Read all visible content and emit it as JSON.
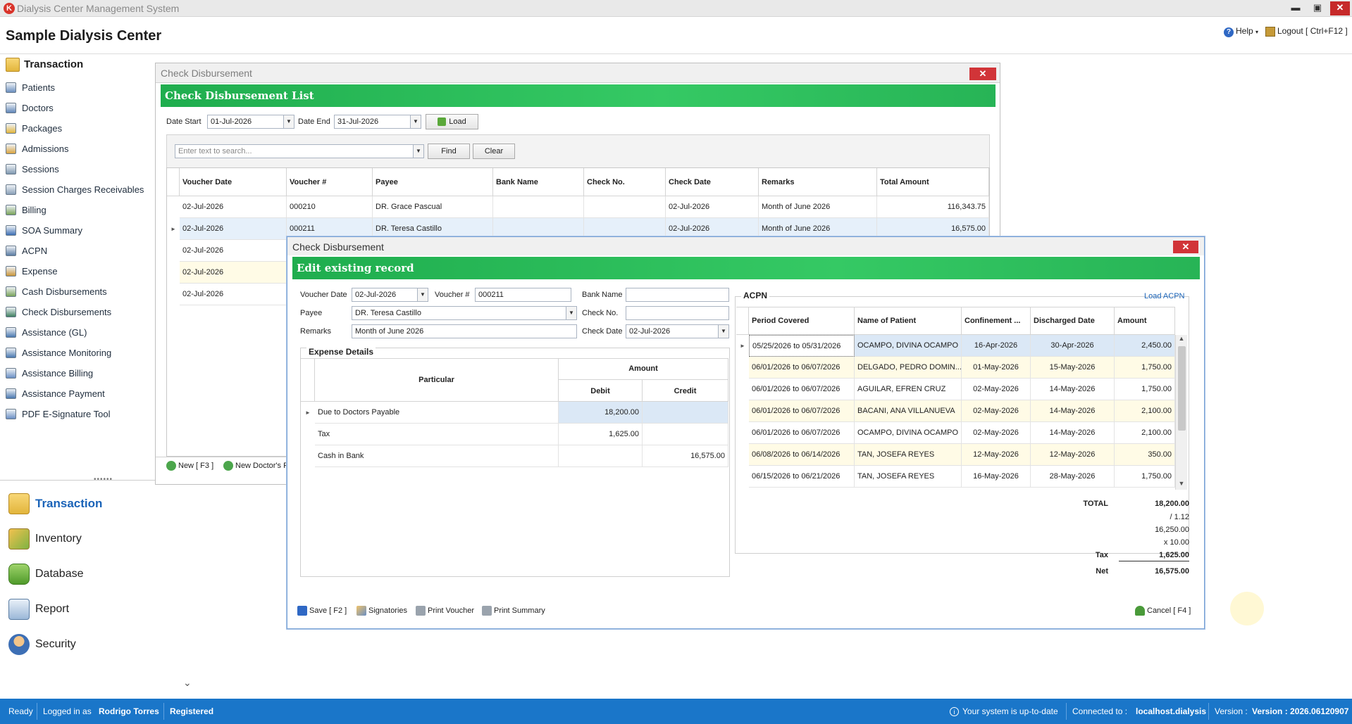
{
  "app": {
    "title": "Dialysis Center Management System",
    "logo_letter": "K",
    "window_controls": {
      "minimize": "▬",
      "restore": "▣",
      "close": "✕"
    }
  },
  "header": {
    "center_name": "Sample Dialysis Center",
    "help_label": "Help",
    "logout_label": "Logout [ Ctrl+F12 ]"
  },
  "sidebar": {
    "heading": "Transaction",
    "items": [
      {
        "label": "Patients",
        "icon": "patients-icon"
      },
      {
        "label": "Doctors",
        "icon": "doctors-icon"
      },
      {
        "label": "Packages",
        "icon": "packages-icon"
      },
      {
        "label": "Admissions",
        "icon": "admissions-icon"
      },
      {
        "label": "Sessions",
        "icon": "sessions-icon"
      },
      {
        "label": "Session Charges Receivables",
        "icon": "receivables-icon"
      },
      {
        "label": "Billing",
        "icon": "billing-icon"
      },
      {
        "label": "SOA Summary",
        "icon": "soa-icon"
      },
      {
        "label": "ACPN",
        "icon": "acpn-icon"
      },
      {
        "label": "Expense",
        "icon": "expense-icon"
      },
      {
        "label": "Cash Disbursements",
        "icon": "cash-icon"
      },
      {
        "label": "Check Disbursements",
        "icon": "check-icon"
      },
      {
        "label": "Assistance (GL)",
        "icon": "assistance-gl-icon"
      },
      {
        "label": "Assistance Monitoring",
        "icon": "monitoring-icon"
      },
      {
        "label": "Assistance Billing",
        "icon": "assistance-billing-icon"
      },
      {
        "label": "Assistance Payment",
        "icon": "assistance-payment-icon"
      },
      {
        "label": "PDF E-Signature Tool",
        "icon": "pen-icon"
      }
    ],
    "splitter": "••••••",
    "modules": [
      {
        "label": "Transaction",
        "icon": "folder-icon"
      },
      {
        "label": "Inventory",
        "icon": "boxes-icon"
      },
      {
        "label": "Database",
        "icon": "database-icon"
      },
      {
        "label": "Report",
        "icon": "report-icon"
      },
      {
        "label": "Security",
        "icon": "user-security-icon"
      }
    ],
    "expand_chevron": "⌄"
  },
  "list_window": {
    "title": "Check Disbursement",
    "banner": "Check Disbursement List",
    "date_start_label": "Date Start",
    "date_start": "01-Jul-2026",
    "date_end_label": "Date End",
    "date_end": "31-Jul-2026",
    "load_label": "Load",
    "search_placeholder": "Enter text to search...",
    "find_label": "Find",
    "clear_label": "Clear",
    "columns": [
      "Voucher Date",
      "Voucher #",
      "Payee",
      "Bank Name",
      "Check No.",
      "Check Date",
      "Remarks",
      "Total Amount"
    ],
    "rows": [
      [
        "02-Jul-2026",
        "000210",
        "DR. Grace Pascual",
        "",
        "",
        "02-Jul-2026",
        "Month of June 2026",
        "116,343.75"
      ],
      [
        "02-Jul-2026",
        "000211",
        "DR. Teresa Castillo",
        "",
        "",
        "02-Jul-2026",
        "Month of June 2026",
        "16,575.00"
      ],
      [
        "02-Jul-2026",
        "",
        "",
        "",
        "",
        "",
        "",
        ""
      ],
      [
        "02-Jul-2026",
        "",
        "",
        "",
        "",
        "",
        "",
        ""
      ],
      [
        "02-Jul-2026",
        "",
        "",
        "",
        "",
        "",
        "",
        ""
      ]
    ],
    "new_label": "New [ F3 ]",
    "new_doctor_label": "New Doctor's F"
  },
  "edit_dialog": {
    "title": "Check Disbursement",
    "banner": "Edit existing record",
    "voucher_date_label": "Voucher Date",
    "voucher_date": "02-Jul-2026",
    "voucher_no_label": "Voucher #",
    "voucher_no": "000211",
    "bank_name_label": "Bank Name",
    "bank_name": "",
    "payee_label": "Payee",
    "payee": "DR. Teresa Castillo",
    "check_no_label": "Check No.",
    "check_no": "",
    "remarks_label": "Remarks",
    "remarks": "Month of June 2026",
    "check_date_label": "Check Date",
    "check_date": "02-Jul-2026",
    "expense_title": "Expense Details",
    "expense_headers": {
      "particular": "Particular",
      "amount": "Amount",
      "debit": "Debit",
      "credit": "Credit"
    },
    "expense_rows": [
      {
        "particular": "Due to Doctors Payable",
        "debit": "18,200.00",
        "credit": ""
      },
      {
        "particular": "Tax",
        "debit": "1,625.00",
        "credit": ""
      },
      {
        "particular": "Cash in Bank",
        "debit": "",
        "credit": "16,575.00"
      }
    ],
    "acpn_title": "ACPN",
    "load_acpn_label": "Load ACPN",
    "acpn_columns": [
      "Period Covered",
      "Name of Patient",
      "Confinement ...",
      "Discharged Date",
      "Amount"
    ],
    "acpn_rows": [
      [
        "05/25/2026 to 05/31/2026",
        "OCAMPO, DIVINA OCAMPO",
        "16-Apr-2026",
        "30-Apr-2026",
        "2,450.00"
      ],
      [
        "06/01/2026 to 06/07/2026",
        "DELGADO, PEDRO DOMIN...",
        "01-May-2026",
        "15-May-2026",
        "1,750.00"
      ],
      [
        "06/01/2026 to 06/07/2026",
        "AGUILAR, EFREN CRUZ",
        "02-May-2026",
        "14-May-2026",
        "1,750.00"
      ],
      [
        "06/01/2026 to 06/07/2026",
        "BACANI, ANA VILLANUEVA",
        "02-May-2026",
        "14-May-2026",
        "2,100.00"
      ],
      [
        "06/01/2026 to 06/07/2026",
        "OCAMPO, DIVINA OCAMPO",
        "02-May-2026",
        "14-May-2026",
        "2,100.00"
      ],
      [
        "06/08/2026 to 06/14/2026",
        "TAN, JOSEFA REYES",
        "12-May-2026",
        "12-May-2026",
        "350.00"
      ],
      [
        "06/15/2026 to 06/21/2026",
        "TAN, JOSEFA REYES",
        "16-May-2026",
        "28-May-2026",
        "1,750.00"
      ]
    ],
    "summary": {
      "total_label": "TOTAL",
      "total": "18,200.00",
      "divisor": "/ 1.12",
      "net_of_vat": "16,250.00",
      "rate": "x 10.00",
      "tax_label": "Tax",
      "tax": "1,625.00",
      "net_label": "Net",
      "net": "16,575.00"
    },
    "save_label": "Save [ F2 ]",
    "signatories_label": "Signatories",
    "print_voucher_label": "Print Voucher",
    "print_summary_label": "Print Summary",
    "cancel_label": "Cancel [ F4 ]"
  },
  "statusbar": {
    "ready": "Ready",
    "logged_in_label": "Logged in as",
    "user": "Rodrigo Torres",
    "registered": "Registered",
    "update_status": "Your system is up-to-date",
    "connected_label": "Connected to :",
    "server": "localhost.dialysis",
    "version_label": "Version :",
    "version": "Version : 2026.06120907"
  },
  "colors": {
    "banner_green": "#27b456",
    "statusbar_blue": "#1a76c9",
    "close_red": "#d13438",
    "selection": "#dbe8f6",
    "link_blue": "#1a63b8"
  }
}
